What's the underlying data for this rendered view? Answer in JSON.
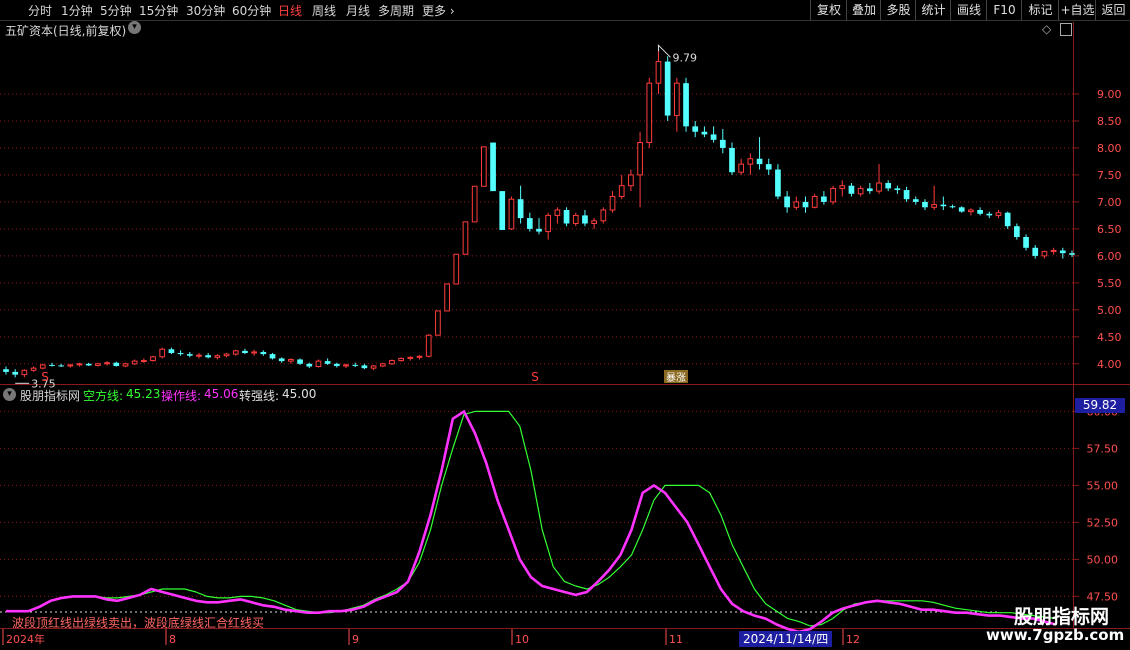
{
  "toolbar": {
    "items": [
      "分时",
      "1分钟",
      "5分钟",
      "15分钟",
      "30分钟",
      "60分钟",
      "日线",
      "周线",
      "月线",
      "多周期",
      "更多"
    ],
    "active": "日线",
    "right_buttons": [
      "复权",
      "叠加",
      "多股",
      "统计",
      "画线",
      "F10",
      "标记",
      "+自选",
      "返回"
    ]
  },
  "price_panel": {
    "title": "五矿资本(日线,前复权)",
    "high_marker": "9.79",
    "low_marker": "3.75",
    "y_labels": [
      "9.00",
      "8.50",
      "8.00",
      "7.50",
      "7.00",
      "6.50",
      "6.00",
      "5.50",
      "5.00",
      "4.50",
      "4.00"
    ],
    "signal_s": "S",
    "signal_s2": "S",
    "badge": "暴涨"
  },
  "indicator_panel": {
    "name": "股朋指标网",
    "line1_label": "空方线:",
    "line1_value": "45.23",
    "line2_label": "操作线:",
    "line2_value": "45.06",
    "line3_label": "转强线:",
    "line3_value": "45.00",
    "current_value": "59.82",
    "y_labels": [
      "60.00",
      "57.50",
      "55.00",
      "52.50",
      "50.00",
      "47.50"
    ],
    "note": "波段顶红线出绿线卖出，波段底绿线汇合红线买"
  },
  "x_axis": {
    "labels": [
      "2024年",
      "8",
      "9",
      "10",
      "11",
      "12"
    ],
    "cursor_date": "2024/11/14/四"
  },
  "watermark": {
    "title": "股朋指标网",
    "url": "www.7gpzb.com"
  },
  "colors": {
    "up": "#ff3c3c",
    "down": "#54ffff",
    "grid": "#8a1a1a",
    "green_line": "#33ff33",
    "magenta_line": "#ff33ff",
    "cursor_box": "#1e1ea0"
  },
  "chart_data": [
    {
      "type": "candlestick",
      "title": "五矿资本(日线,前复权)",
      "ylim": [
        3.7,
        10.0
      ],
      "ohlc": [
        [
          3.9,
          3.95,
          3.8,
          3.85
        ],
        [
          3.85,
          3.9,
          3.75,
          3.8
        ],
        [
          3.8,
          3.9,
          3.75,
          3.88
        ],
        [
          3.88,
          3.95,
          3.85,
          3.92
        ],
        [
          3.92,
          4.0,
          3.9,
          3.98
        ],
        [
          3.98,
          4.02,
          3.95,
          3.97
        ],
        [
          3.97,
          4.0,
          3.94,
          3.96
        ],
        [
          3.96,
          4.0,
          3.93,
          3.98
        ],
        [
          3.98,
          4.02,
          3.95,
          4.0
        ],
        [
          4.0,
          4.02,
          3.96,
          3.97
        ],
        [
          3.97,
          4.02,
          3.95,
          4.0
        ],
        [
          4.0,
          4.05,
          3.97,
          4.02
        ],
        [
          4.02,
          4.04,
          3.95,
          3.96
        ],
        [
          3.96,
          4.02,
          3.94,
          4.0
        ],
        [
          4.0,
          4.08,
          3.98,
          4.05
        ],
        [
          4.05,
          4.1,
          4.02,
          4.06
        ],
        [
          4.06,
          4.15,
          4.04,
          4.13
        ],
        [
          4.13,
          4.3,
          4.1,
          4.27
        ],
        [
          4.27,
          4.3,
          4.18,
          4.2
        ],
        [
          4.2,
          4.25,
          4.15,
          4.18
        ],
        [
          4.18,
          4.22,
          4.12,
          4.15
        ],
        [
          4.15,
          4.2,
          4.1,
          4.16
        ],
        [
          4.16,
          4.2,
          4.1,
          4.12
        ],
        [
          4.12,
          4.18,
          4.08,
          4.15
        ],
        [
          4.15,
          4.2,
          4.12,
          4.18
        ],
        [
          4.18,
          4.26,
          4.15,
          4.24
        ],
        [
          4.24,
          4.28,
          4.18,
          4.2
        ],
        [
          4.2,
          4.26,
          4.15,
          4.22
        ],
        [
          4.22,
          4.25,
          4.15,
          4.18
        ],
        [
          4.18,
          4.2,
          4.08,
          4.1
        ],
        [
          4.1,
          4.12,
          4.02,
          4.05
        ],
        [
          4.05,
          4.1,
          4.0,
          4.08
        ],
        [
          4.08,
          4.1,
          3.98,
          4.0
        ],
        [
          4.0,
          4.02,
          3.92,
          3.95
        ],
        [
          3.95,
          4.08,
          3.93,
          4.05
        ],
        [
          4.05,
          4.1,
          3.98,
          4.0
        ],
        [
          4.0,
          4.02,
          3.93,
          3.96
        ],
        [
          3.96,
          4.0,
          3.92,
          3.98
        ],
        [
          3.98,
          4.02,
          3.94,
          3.97
        ],
        [
          3.97,
          4.0,
          3.9,
          3.92
        ],
        [
          3.92,
          3.98,
          3.88,
          3.96
        ],
        [
          3.96,
          4.02,
          3.94,
          4.0
        ],
        [
          4.0,
          4.08,
          3.98,
          4.06
        ],
        [
          4.06,
          4.12,
          4.04,
          4.1
        ],
        [
          4.1,
          4.14,
          4.06,
          4.12
        ],
        [
          4.12,
          4.16,
          4.08,
          4.14
        ],
        [
          4.14,
          4.55,
          4.12,
          4.53
        ],
        [
          4.53,
          4.98,
          4.53,
          4.98
        ],
        [
          4.98,
          5.48,
          4.98,
          5.48
        ],
        [
          5.48,
          6.03,
          5.48,
          6.03
        ],
        [
          6.03,
          6.63,
          6.03,
          6.63
        ],
        [
          6.63,
          7.29,
          6.63,
          7.29
        ],
        [
          7.29,
          8.02,
          7.29,
          8.02
        ],
        [
          8.1,
          8.1,
          7.2,
          7.2
        ],
        [
          7.2,
          7.2,
          6.48,
          6.48
        ],
        [
          6.5,
          7.1,
          6.48,
          7.05
        ],
        [
          7.05,
          7.3,
          6.6,
          6.7
        ],
        [
          6.7,
          6.8,
          6.45,
          6.5
        ],
        [
          6.5,
          6.7,
          6.4,
          6.45
        ],
        [
          6.45,
          6.8,
          6.3,
          6.75
        ],
        [
          6.75,
          6.9,
          6.6,
          6.85
        ],
        [
          6.85,
          6.9,
          6.55,
          6.6
        ],
        [
          6.6,
          6.8,
          6.55,
          6.75
        ],
        [
          6.75,
          6.85,
          6.55,
          6.6
        ],
        [
          6.6,
          6.7,
          6.5,
          6.65
        ],
        [
          6.65,
          6.9,
          6.6,
          6.85
        ],
        [
          6.85,
          7.2,
          6.8,
          7.1
        ],
        [
          7.1,
          7.5,
          7.05,
          7.3
        ],
        [
          7.3,
          7.6,
          7.2,
          7.5
        ],
        [
          7.5,
          8.3,
          6.9,
          8.1
        ],
        [
          8.1,
          9.3,
          8.0,
          9.2
        ],
        [
          9.2,
          9.79,
          9.0,
          9.6
        ],
        [
          9.6,
          9.7,
          8.5,
          8.6
        ],
        [
          8.6,
          9.3,
          8.3,
          9.2
        ],
        [
          9.2,
          9.3,
          8.3,
          8.4
        ],
        [
          8.4,
          8.5,
          8.2,
          8.3
        ],
        [
          8.3,
          8.4,
          8.2,
          8.25
        ],
        [
          8.25,
          8.4,
          8.1,
          8.15
        ],
        [
          8.15,
          8.35,
          7.9,
          8.0
        ],
        [
          8.0,
          8.1,
          7.5,
          7.55
        ],
        [
          7.55,
          7.8,
          7.5,
          7.7
        ],
        [
          7.7,
          7.9,
          7.5,
          7.8
        ],
        [
          7.8,
          8.2,
          7.6,
          7.7
        ],
        [
          7.7,
          7.8,
          7.5,
          7.6
        ],
        [
          7.6,
          7.7,
          7.05,
          7.1
        ],
        [
          7.1,
          7.2,
          6.8,
          6.9
        ],
        [
          6.9,
          7.1,
          6.85,
          7.0
        ],
        [
          7.0,
          7.1,
          6.8,
          6.9
        ],
        [
          6.9,
          7.15,
          6.88,
          7.1
        ],
        [
          7.1,
          7.2,
          6.95,
          7.0
        ],
        [
          7.0,
          7.3,
          6.95,
          7.25
        ],
        [
          7.25,
          7.4,
          7.1,
          7.3
        ],
        [
          7.3,
          7.35,
          7.1,
          7.15
        ],
        [
          7.15,
          7.3,
          7.1,
          7.25
        ],
        [
          7.25,
          7.35,
          7.15,
          7.2
        ],
        [
          7.2,
          7.7,
          7.15,
          7.35
        ],
        [
          7.35,
          7.4,
          7.2,
          7.25
        ],
        [
          7.25,
          7.3,
          7.15,
          7.22
        ],
        [
          7.22,
          7.28,
          7.0,
          7.05
        ],
        [
          7.05,
          7.1,
          6.95,
          7.0
        ],
        [
          7.0,
          7.05,
          6.85,
          6.9
        ],
        [
          6.9,
          7.3,
          6.85,
          6.95
        ],
        [
          6.95,
          7.1,
          6.85,
          6.92
        ],
        [
          6.92,
          6.95,
          6.88,
          6.9
        ],
        [
          6.9,
          6.92,
          6.8,
          6.82
        ],
        [
          6.82,
          6.88,
          6.75,
          6.85
        ],
        [
          6.85,
          6.9,
          6.75,
          6.78
        ],
        [
          6.78,
          6.82,
          6.7,
          6.75
        ],
        [
          6.75,
          6.85,
          6.7,
          6.8
        ],
        [
          6.8,
          6.82,
          6.5,
          6.55
        ],
        [
          6.55,
          6.6,
          6.3,
          6.35
        ],
        [
          6.35,
          6.4,
          6.1,
          6.15
        ],
        [
          6.15,
          6.2,
          5.95,
          6.0
        ],
        [
          6.0,
          6.1,
          5.95,
          6.08
        ],
        [
          6.08,
          6.15,
          6.02,
          6.1
        ],
        [
          6.1,
          6.15,
          5.95,
          6.05
        ],
        [
          6.05,
          6.1,
          5.98,
          6.02
        ]
      ]
    },
    {
      "type": "line",
      "ylim": [
        45.5,
        60.5
      ],
      "series": [
        {
          "name": "空方线",
          "color": "#33ff33",
          "values": [
            46.5,
            46.5,
            46.5,
            46.8,
            47.2,
            47.4,
            47.5,
            47.5,
            47.5,
            47.4,
            47.4,
            47.5,
            47.6,
            47.8,
            48.0,
            48.0,
            48.0,
            47.8,
            47.5,
            47.4,
            47.4,
            47.5,
            47.5,
            47.4,
            47.2,
            46.9,
            46.6,
            46.5,
            46.4,
            46.4,
            46.5,
            46.7,
            46.9,
            47.3,
            47.6,
            48.0,
            48.5,
            49.8,
            52.0,
            55.0,
            57.5,
            59.8,
            60.0,
            60.0,
            60.0,
            60.0,
            59.0,
            56.0,
            52.0,
            49.5,
            48.5,
            48.2,
            48.0,
            48.3,
            48.8,
            49.5,
            50.3,
            52.0,
            54.0,
            55.0,
            55.0,
            55.0,
            55.0,
            54.5,
            53.0,
            51.0,
            49.5,
            48.0,
            47.0,
            46.5,
            46.0,
            45.8,
            45.5,
            45.6,
            46.0,
            46.6,
            47.0,
            47.1,
            47.2,
            47.2,
            47.2,
            47.2,
            47.2,
            47.1,
            46.9,
            46.7,
            46.6,
            46.5,
            46.4,
            46.4,
            46.4,
            46.3,
            46.2,
            46.1,
            46.0
          ]
        },
        {
          "name": "操作线",
          "color": "#ff33ff",
          "values": [
            46.5,
            46.5,
            46.5,
            46.8,
            47.2,
            47.4,
            47.5,
            47.5,
            47.5,
            47.3,
            47.2,
            47.4,
            47.6,
            48.0,
            47.8,
            47.6,
            47.4,
            47.2,
            47.1,
            47.1,
            47.2,
            47.3,
            47.1,
            46.9,
            46.8,
            46.6,
            46.5,
            46.4,
            46.4,
            46.5,
            46.5,
            46.6,
            46.8,
            47.2,
            47.5,
            47.8,
            48.5,
            50.5,
            53.0,
            56.0,
            59.5,
            60.0,
            58.5,
            56.5,
            54.0,
            52.0,
            50.0,
            48.8,
            48.2,
            48.0,
            47.8,
            47.6,
            47.8,
            48.5,
            49.3,
            50.3,
            52.0,
            54.5,
            55.0,
            54.5,
            53.5,
            52.5,
            51.0,
            49.5,
            48.0,
            47.0,
            46.5,
            46.2,
            46.0,
            45.6,
            45.3,
            45.1,
            45.3,
            45.8,
            46.4,
            46.7,
            46.9,
            47.1,
            47.2,
            47.1,
            47.0,
            46.8,
            46.6,
            46.6,
            46.5,
            46.4,
            46.4,
            46.3,
            46.2,
            46.2,
            46.1,
            46.0,
            46.0,
            45.8,
            45.6
          ]
        }
      ]
    }
  ]
}
